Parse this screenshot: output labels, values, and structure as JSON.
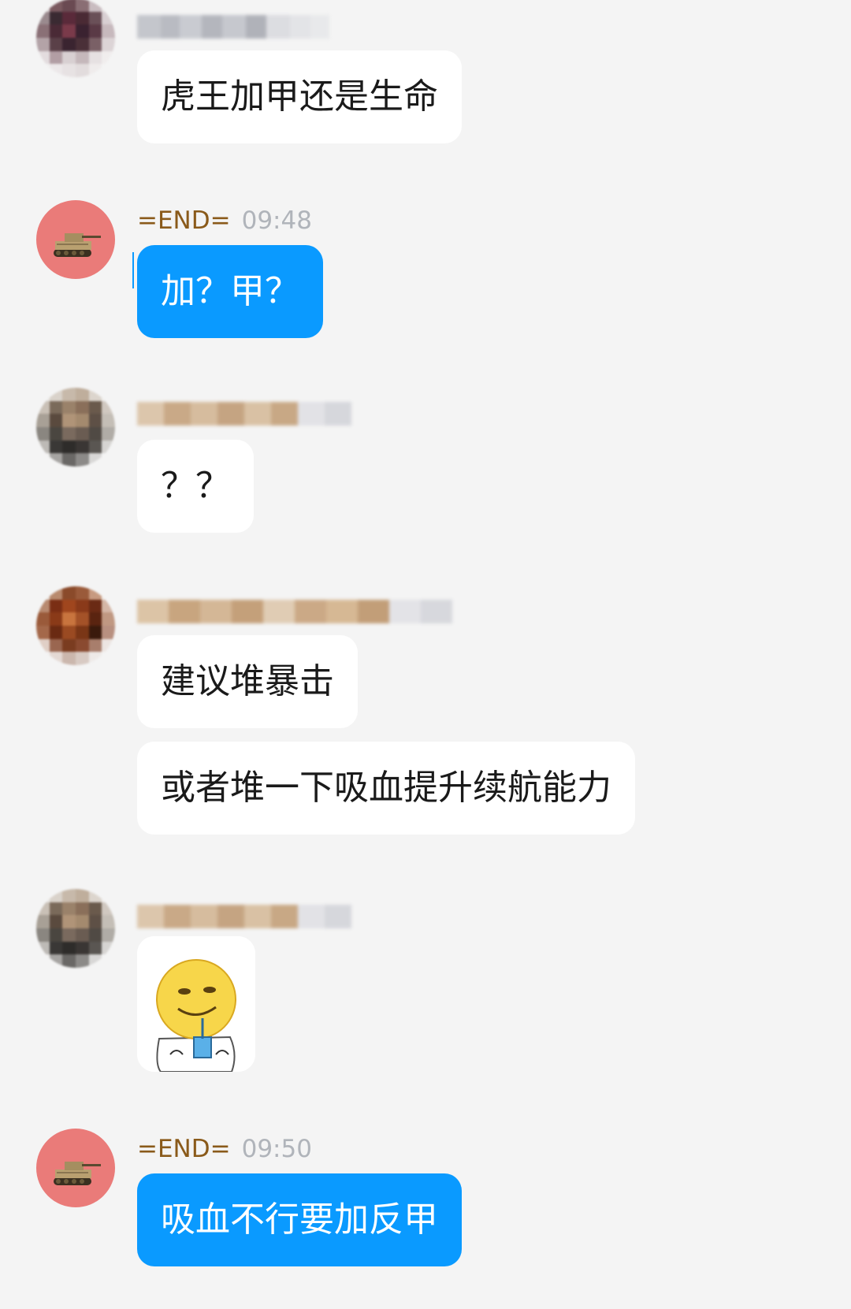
{
  "colors": {
    "background": "#f4f4f4",
    "outgoing_bubble": "#0a9aff",
    "incoming_bubble": "#ffffff",
    "sender_name": "#8a5a1a",
    "timestamp": "#b0b4ba",
    "self_avatar_bg": "#ea7b79"
  },
  "messages": [
    {
      "sender_blurred": true,
      "avatar": "pixelated-avatar",
      "bubbles": [
        {
          "type": "text",
          "direction": "in",
          "text": "虎王加甲还是生命"
        }
      ]
    },
    {
      "sender": "=END=",
      "time": "09:48",
      "avatar": "tank-icon",
      "bubbles": [
        {
          "type": "text",
          "direction": "out",
          "text": "加？甲？"
        }
      ]
    },
    {
      "sender_blurred": true,
      "avatar": "pixelated-avatar",
      "bubbles": [
        {
          "type": "text",
          "direction": "in",
          "text": "？？"
        }
      ]
    },
    {
      "sender_blurred": true,
      "avatar": "pixelated-avatar",
      "bubbles": [
        {
          "type": "text",
          "direction": "in",
          "text": "建议堆暴击"
        },
        {
          "type": "text",
          "direction": "in",
          "text": "或者堆一下吸血提升续航能力"
        }
      ]
    },
    {
      "sender_blurred": true,
      "avatar": "pixelated-avatar",
      "bubbles": [
        {
          "type": "sticker",
          "direction": "in",
          "sticker": "smiley-drinking-sticker"
        }
      ]
    },
    {
      "sender": "=END=",
      "time": "09:50",
      "avatar": "tank-icon",
      "bubbles": [
        {
          "type": "text",
          "direction": "out",
          "text": "吸血不行要加反甲"
        }
      ]
    }
  ]
}
